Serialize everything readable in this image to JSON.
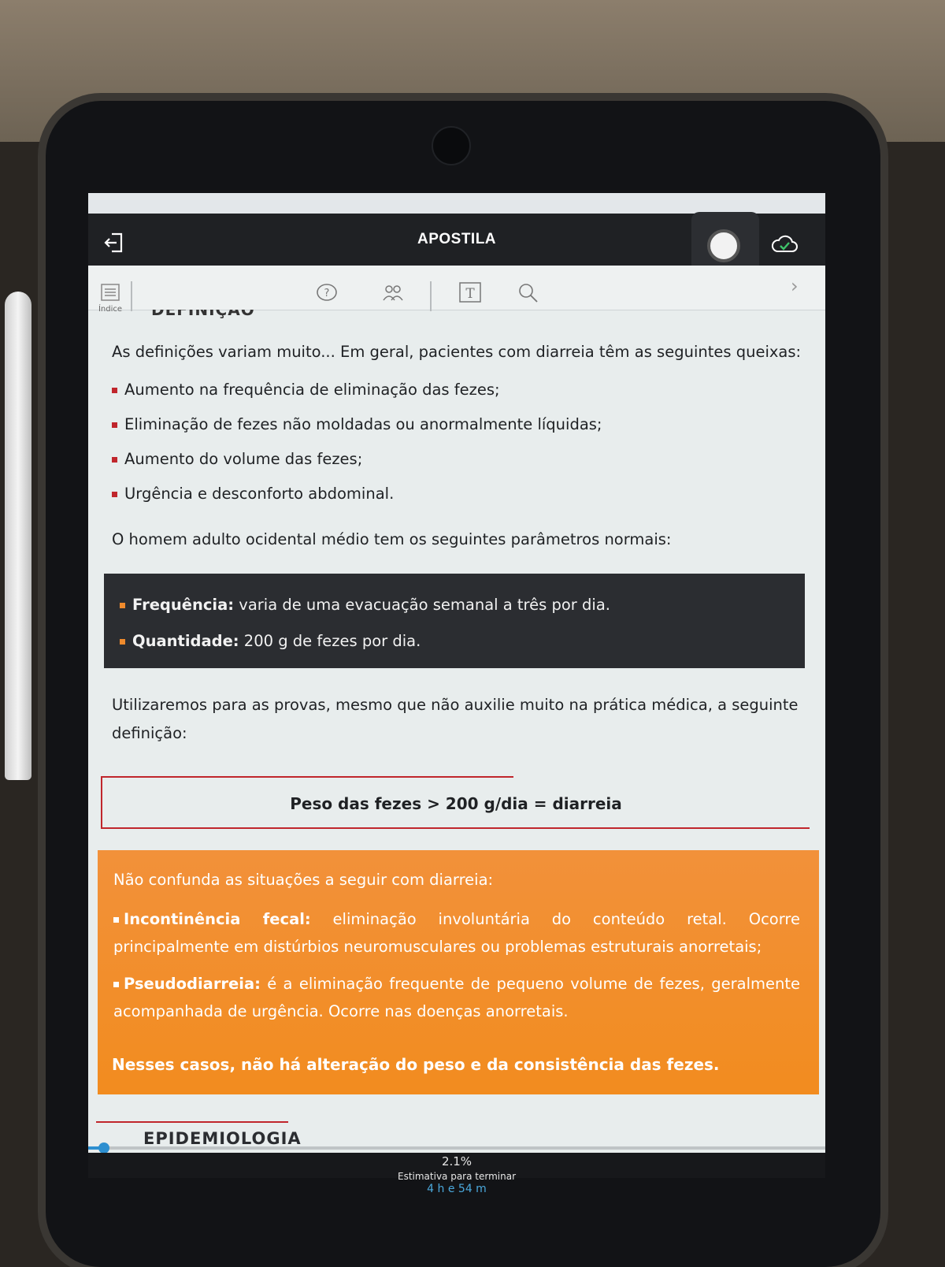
{
  "app": {
    "title": "APOSTILA"
  },
  "toolbar": {
    "index_label": "Índice"
  },
  "content": {
    "section_heading_partial": "DEFINIÇÃO",
    "intro": "As definições variam muito... Em geral, pacientes com diarreia têm as seguintes queixas:",
    "complaints": [
      "Aumento na frequência de eliminação das fezes;",
      "Eliminação de fezes não moldadas ou anormalmente líquidas;",
      "Aumento do volume das fezes;",
      "Urgência e desconforto abdominal."
    ],
    "params_intro": "O homem adulto ocidental médio tem os seguintes parâmetros normais:",
    "params": [
      {
        "label": "Frequência:",
        "text": " varia de uma evacuação semanal a três por dia."
      },
      {
        "label": "Quantidade:",
        "text": " 200 g de fezes por dia."
      }
    ],
    "definition_intro": "Utilizaremos para as provas, mesmo que não auxilie muito na prática médica, a seguinte definição:",
    "definition": "Peso das fezes > 200 g/dia = diarreia",
    "warning": {
      "intro": "Não confunda as situações a seguir com diarreia:",
      "items": [
        {
          "label": "Incontinência fecal:",
          "text": " eliminação involuntária do conteúdo retal. Ocorre principalmente em distúrbios neuromusculares ou problemas estruturais anorretais;"
        },
        {
          "label": "Pseudodiarreia:",
          "text": " é a eliminação frequente de pequeno volume de fezes, geralmente acompanhada de urgência. Ocorre nas doenças anorretais."
        }
      ],
      "note": "Nesses casos, não há alteração do peso e da consistência das fezes."
    },
    "next_heading": "EPIDEMIOLOGIA"
  },
  "progress": {
    "percent_text": "2.1%",
    "fraction": 0.021,
    "estimate_label": "Estimativa para terminar",
    "estimate_time": "4 h e 54 m"
  },
  "colors": {
    "accent_red": "#c0262c",
    "accent_orange": "#f28c1f",
    "dark_box": "#2b2d31",
    "progress_blue": "#2d8fd0"
  },
  "icons": [
    "exit-icon",
    "record-button-icon",
    "cloud-check-icon",
    "index-list-icon",
    "question-icon",
    "people-icon",
    "text-format-icon",
    "search-icon",
    "chevron-right-icon"
  ]
}
